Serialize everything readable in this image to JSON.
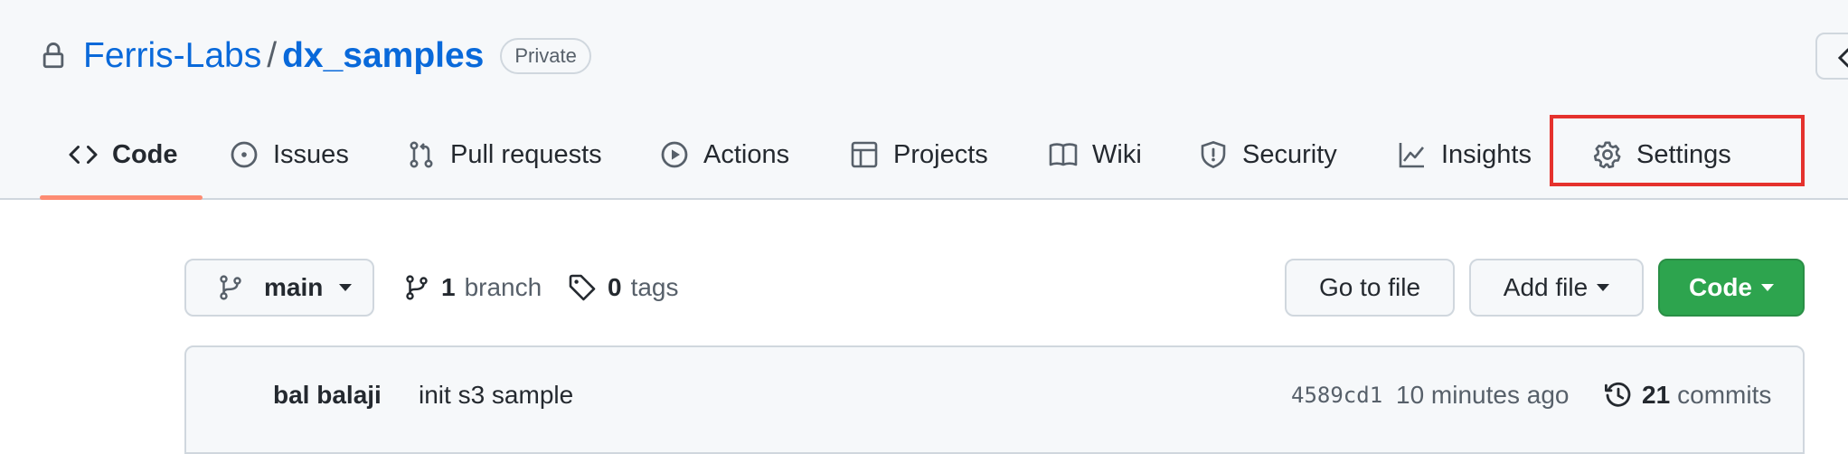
{
  "repo": {
    "owner": "Ferris-Labs",
    "separator": "/",
    "name": "dx_samples",
    "visibility": "Private"
  },
  "tabs": [
    {
      "label": "Code",
      "icon": "code-icon",
      "selected": true
    },
    {
      "label": "Issues",
      "icon": "issue-opened-icon"
    },
    {
      "label": "Pull requests",
      "icon": "git-pull-request-icon"
    },
    {
      "label": "Actions",
      "icon": "play-icon"
    },
    {
      "label": "Projects",
      "icon": "table-icon"
    },
    {
      "label": "Wiki",
      "icon": "book-icon"
    },
    {
      "label": "Security",
      "icon": "shield-icon"
    },
    {
      "label": "Insights",
      "icon": "graph-icon"
    },
    {
      "label": "Settings",
      "icon": "gear-icon",
      "highlighted": true
    }
  ],
  "toolbar": {
    "branch": "main",
    "branches_count": "1",
    "branches_label": "branch",
    "tags_count": "0",
    "tags_label": "tags",
    "go_to_file": "Go to file",
    "add_file": "Add file",
    "code": "Code"
  },
  "commit": {
    "author": "bal balaji",
    "message": "init s3 sample",
    "sha": "4589cd1",
    "time": "10 minutes ago",
    "count": "21",
    "count_label": "commits"
  },
  "colors": {
    "accent_link": "#0969da",
    "tab_underline": "#fd8c73",
    "primary_button": "#2da44e",
    "highlight_outline": "#e5322d"
  }
}
